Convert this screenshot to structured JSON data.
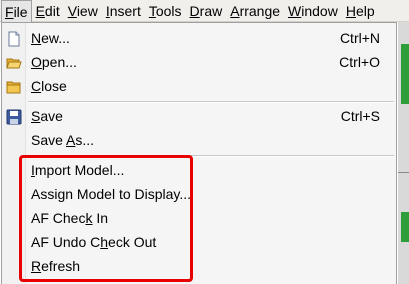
{
  "menubar": {
    "items": [
      {
        "pre": "",
        "acc": "F",
        "post": "ile"
      },
      {
        "pre": "",
        "acc": "E",
        "post": "dit"
      },
      {
        "pre": "",
        "acc": "V",
        "post": "iew"
      },
      {
        "pre": "",
        "acc": "I",
        "post": "nsert"
      },
      {
        "pre": "",
        "acc": "T",
        "post": "ools"
      },
      {
        "pre": "",
        "acc": "D",
        "post": "raw"
      },
      {
        "pre": "",
        "acc": "A",
        "post": "rrange"
      },
      {
        "pre": "",
        "acc": "W",
        "post": "indow"
      },
      {
        "pre": "",
        "acc": "H",
        "post": "elp"
      }
    ]
  },
  "file_menu": {
    "items": [
      {
        "pre": "",
        "acc": "N",
        "post": "ew...",
        "shortcut": "Ctrl+N",
        "icon": "new-document-icon"
      },
      {
        "pre": "",
        "acc": "O",
        "post": "pen...",
        "shortcut": "Ctrl+O",
        "icon": "open-folder-icon"
      },
      {
        "pre": "",
        "acc": "C",
        "post": "lose",
        "shortcut": "",
        "icon": "close-folder-icon"
      },
      {
        "pre": "",
        "acc": "S",
        "post": "ave",
        "shortcut": "Ctrl+S",
        "icon": "save-disk-icon"
      },
      {
        "pre": "Save ",
        "acc": "A",
        "post": "s...",
        "shortcut": "",
        "icon": ""
      },
      {
        "pre": "",
        "acc": "I",
        "post": "mport Model...",
        "shortcut": "",
        "icon": ""
      },
      {
        "pre": "Assi",
        "acc": "g",
        "post": "n Model to Display...",
        "shortcut": "",
        "icon": ""
      },
      {
        "pre": "AF Chec",
        "acc": "k",
        "post": " In",
        "shortcut": "",
        "icon": ""
      },
      {
        "pre": "AF Undo C",
        "acc": "h",
        "post": "eck Out",
        "shortcut": "",
        "icon": ""
      },
      {
        "pre": "",
        "acc": "R",
        "post": "efresh",
        "shortcut": "",
        "icon": ""
      }
    ]
  },
  "colors": {
    "highlight": "#e80000",
    "menu_bg": "#f5f5f5",
    "menubar_bg": "#f0efeb"
  }
}
